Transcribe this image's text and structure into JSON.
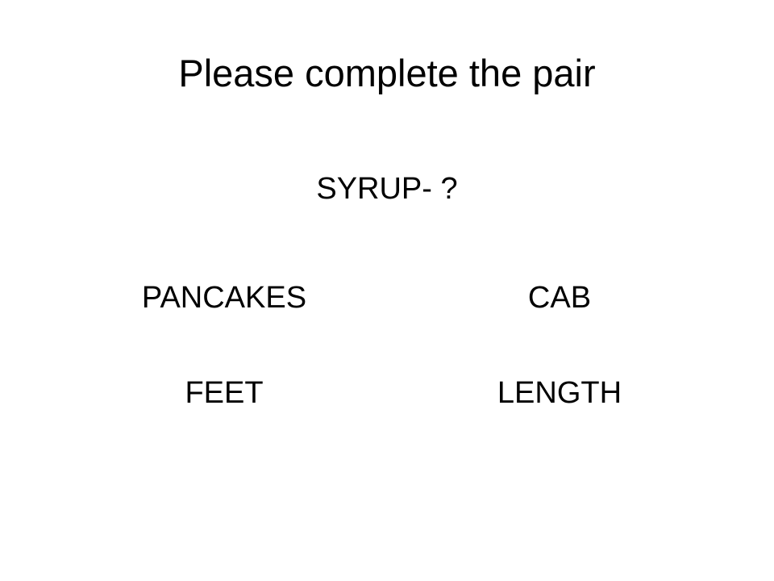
{
  "slide": {
    "title": "Please complete the pair",
    "prompt": "SYRUP- ?",
    "options": [
      {
        "label": "PANCAKES"
      },
      {
        "label": "CAB"
      },
      {
        "label": "FEET"
      },
      {
        "label": "LENGTH"
      }
    ]
  }
}
